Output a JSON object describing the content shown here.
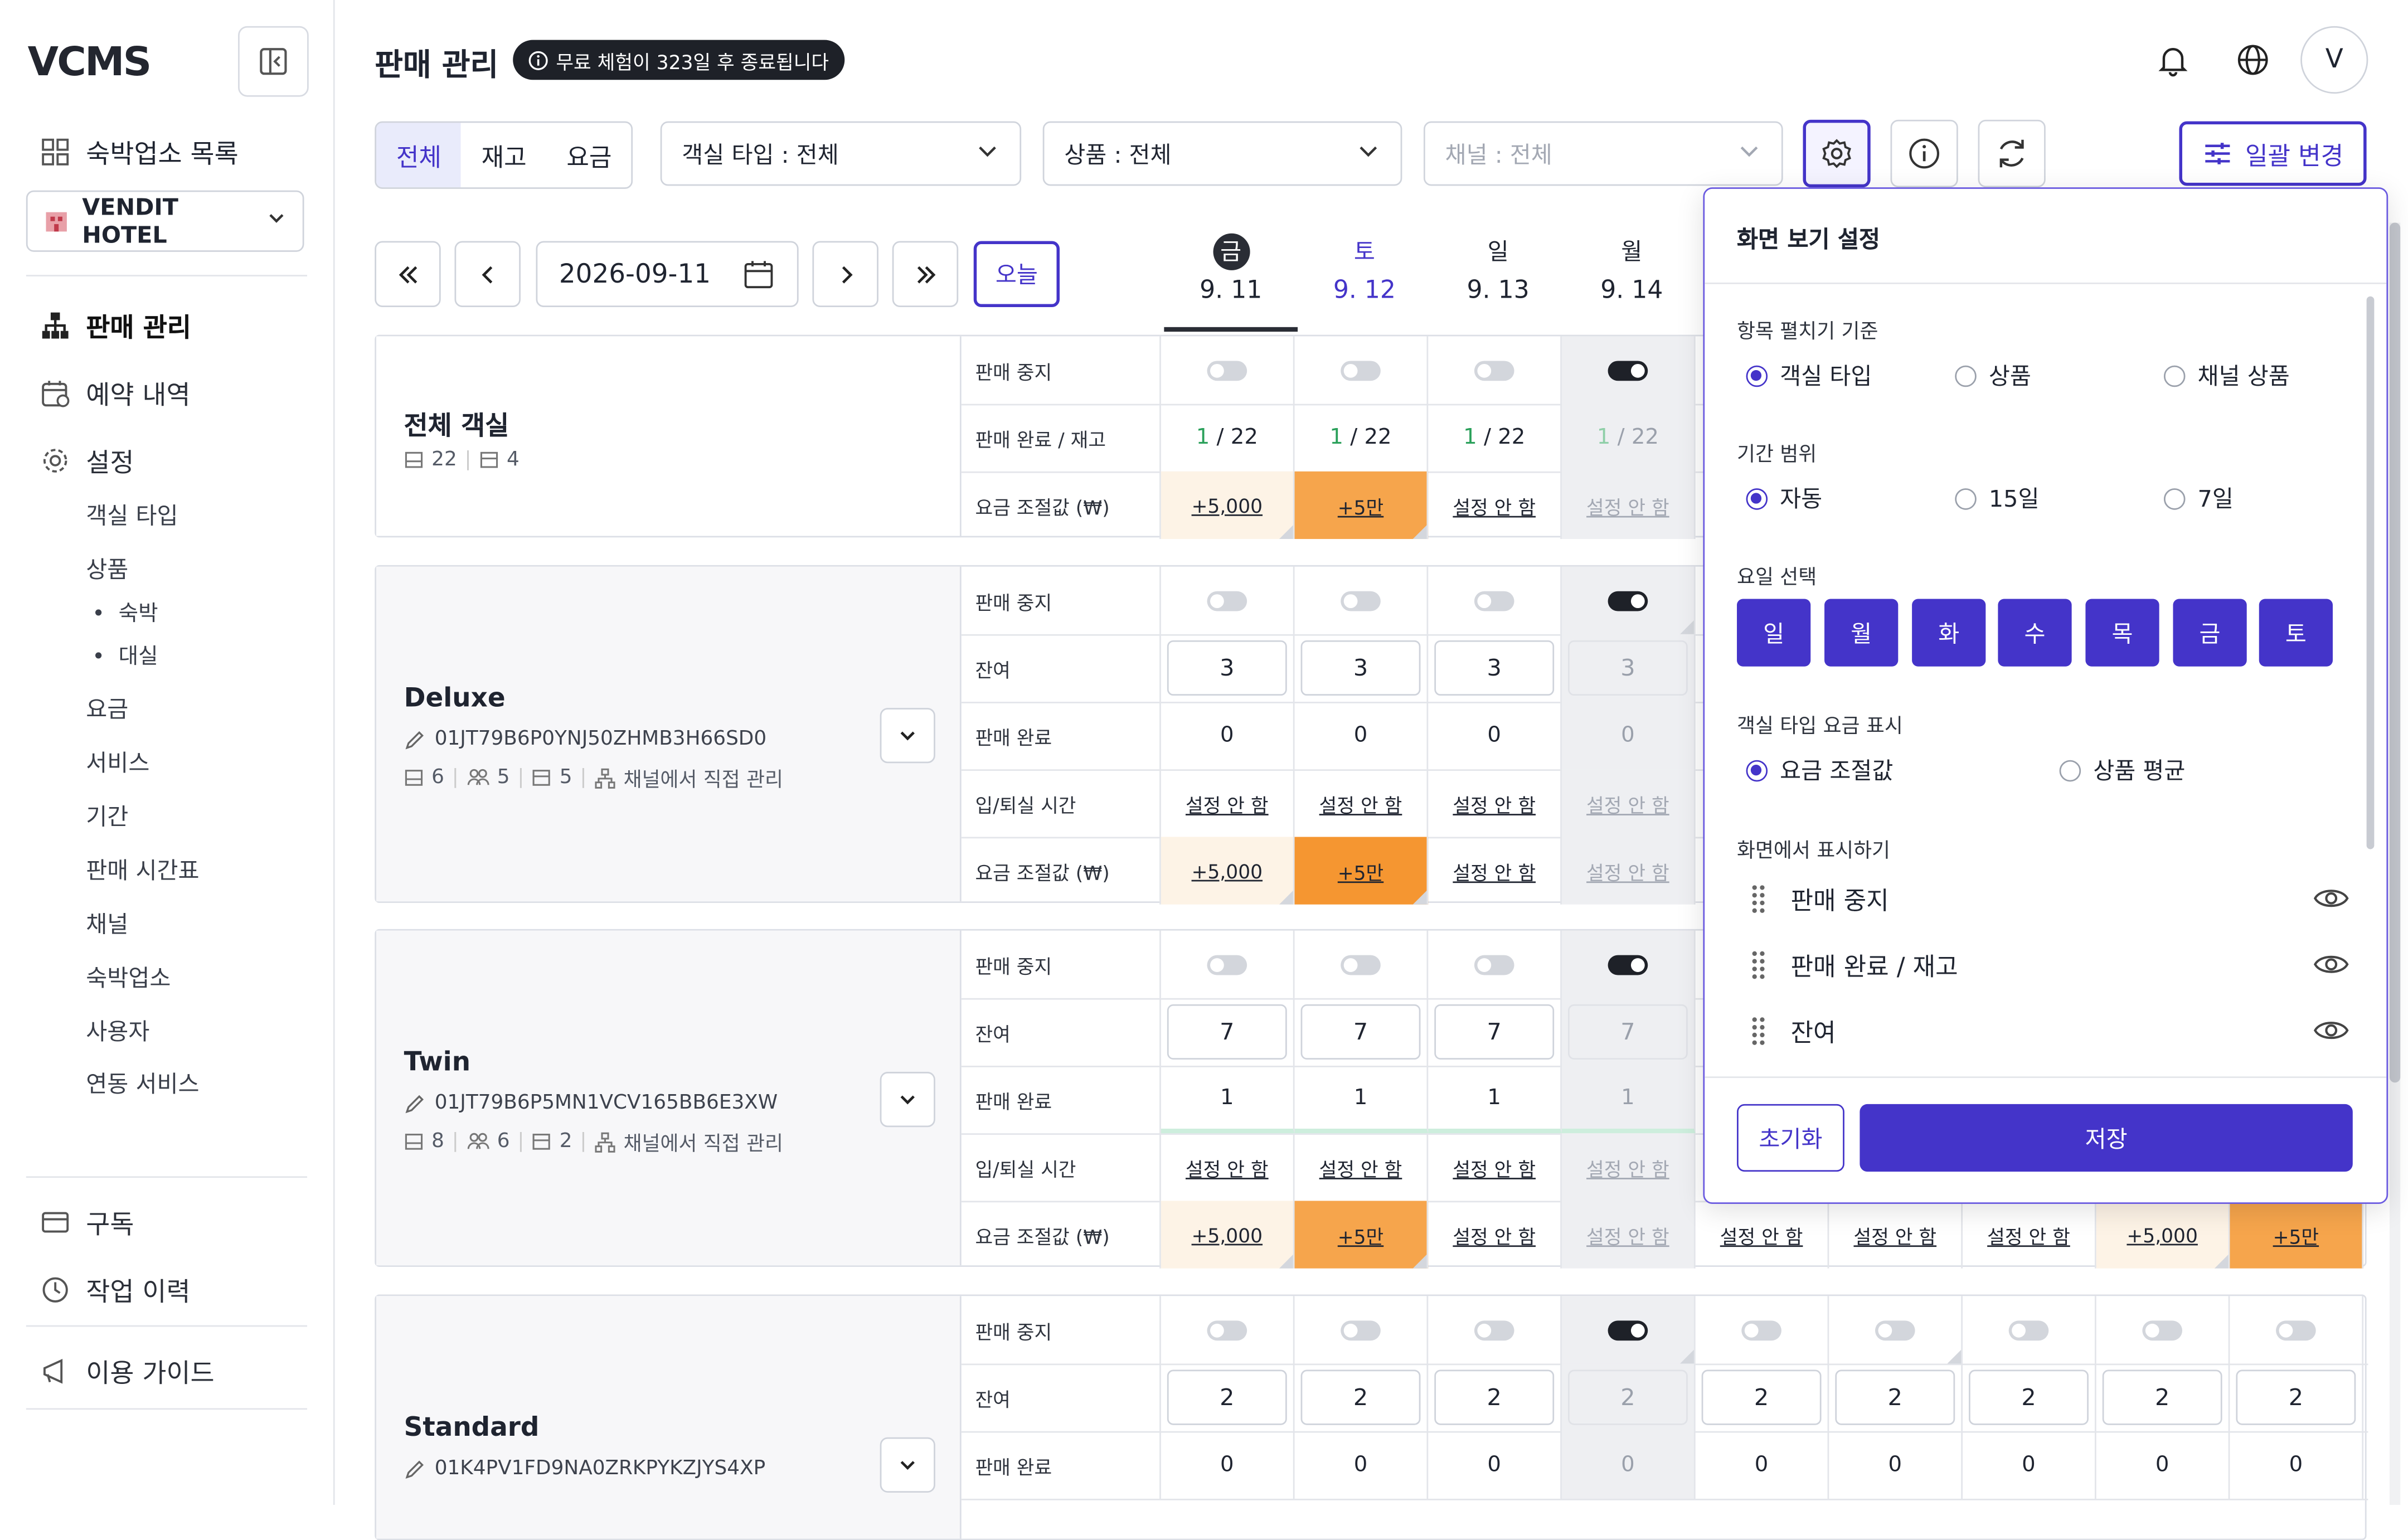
{
  "app": {
    "logo": "VCMS"
  },
  "sidebar": {
    "top_item": "숙박업소 목록",
    "hotel": "VENDIT HOTEL",
    "items": [
      {
        "label": "판매 관리"
      },
      {
        "label": "예약 내역"
      },
      {
        "label": "설정"
      }
    ],
    "settings_sub": [
      "객실 타입",
      "상품",
      "요금",
      "서비스",
      "기간",
      "판매 시간표",
      "채널",
      "숙박업소",
      "사용자",
      "연동 서비스"
    ],
    "product_sub": [
      "숙박",
      "대실"
    ],
    "bottom": [
      "구독",
      "작업 이력",
      "이용 가이드"
    ]
  },
  "header": {
    "title": "판매 관리",
    "trial_badge": "무료 체험이 323일 후 종료됩니다",
    "avatar": "V"
  },
  "filters": {
    "tabs": [
      "전체",
      "재고",
      "요금"
    ],
    "room_type": "객실 타입 : 전체",
    "product": "상품 : 전체",
    "channel": "채널 : 전체",
    "bulk_change": "일괄 변경"
  },
  "date_nav": {
    "date": "2026-09-11",
    "today": "오늘",
    "days": [
      {
        "dow": "금",
        "date": "9. 11"
      },
      {
        "dow": "토",
        "date": "9. 12"
      },
      {
        "dow": "일",
        "date": "9. 13"
      },
      {
        "dow": "월",
        "date": "9. 14"
      }
    ]
  },
  "labels": {
    "stop_sale": "판매 중지",
    "sold_stock": "판매 완료 / 재고",
    "rate_adj": "요금 조절값 (₩)",
    "remaining": "잔여",
    "sold": "판매 완료",
    "checkin": "입/퇴실 시간",
    "not_set": "설정 안 함"
  },
  "rooms": {
    "all": {
      "name": "전체 객실",
      "rooms": "22",
      "beds": "4",
      "sold": [
        "1",
        "1",
        "1",
        "1"
      ],
      "stock": [
        "/ 22",
        "/ 22",
        "/ 22",
        "/ 22"
      ],
      "rates": [
        "+5,000",
        "+5만"
      ]
    },
    "deluxe": {
      "name": "Deluxe",
      "code": "01JT79B6P0YNJ50ZHMB3H66SD0",
      "rooms": "6",
      "guests": "5",
      "beds": "5",
      "channel": "채널에서 직접 관리",
      "remaining": [
        "3",
        "3",
        "3",
        "3"
      ],
      "sold": [
        "0",
        "0",
        "0",
        "0"
      ],
      "rates": [
        "+5,000",
        "+5만"
      ]
    },
    "twin": {
      "name": "Twin",
      "code": "01JT79B6P5MN1VCV165BB6E3XW",
      "rooms": "8",
      "guests": "6",
      "beds": "2",
      "channel": "채널에서 직접 관리",
      "remaining": [
        "7",
        "7",
        "7",
        "7"
      ],
      "sold": [
        "1",
        "1",
        "1",
        "1"
      ],
      "rates": [
        "+5,000",
        "+5만",
        "+5,000",
        "+5만"
      ]
    },
    "standard": {
      "name": "Standard",
      "code": "01K4PV1FD9NA0ZRKPYKZJYS4XP",
      "remaining": [
        "2",
        "2",
        "2",
        "2",
        "2",
        "2",
        "2",
        "2",
        "2"
      ],
      "sold": [
        "0",
        "0",
        "0",
        "0",
        "0",
        "0",
        "0",
        "0",
        "0"
      ]
    }
  },
  "panel": {
    "title": "화면 보기 설정",
    "expand_label": "항목 펼치기 기준",
    "expand_options": [
      "객실 타입",
      "상품",
      "채널 상품"
    ],
    "period_label": "기간 범위",
    "period_options": [
      "자동",
      "15일",
      "7일"
    ],
    "day_label": "요일 선택",
    "days": [
      "일",
      "월",
      "화",
      "수",
      "목",
      "금",
      "토"
    ],
    "rate_label": "객실 타입 요금 표시",
    "rate_options": [
      "요금 조절값",
      "상품 평균"
    ],
    "show_label": "화면에서 표시하기",
    "show_items": [
      "판매 중지",
      "판매 완료 / 재고",
      "잔여"
    ],
    "reset": "초기화",
    "save": "저장"
  },
  "colors": {
    "accent": "#4434c9",
    "orange": "#f6a54c",
    "green": "#2aa05a"
  }
}
